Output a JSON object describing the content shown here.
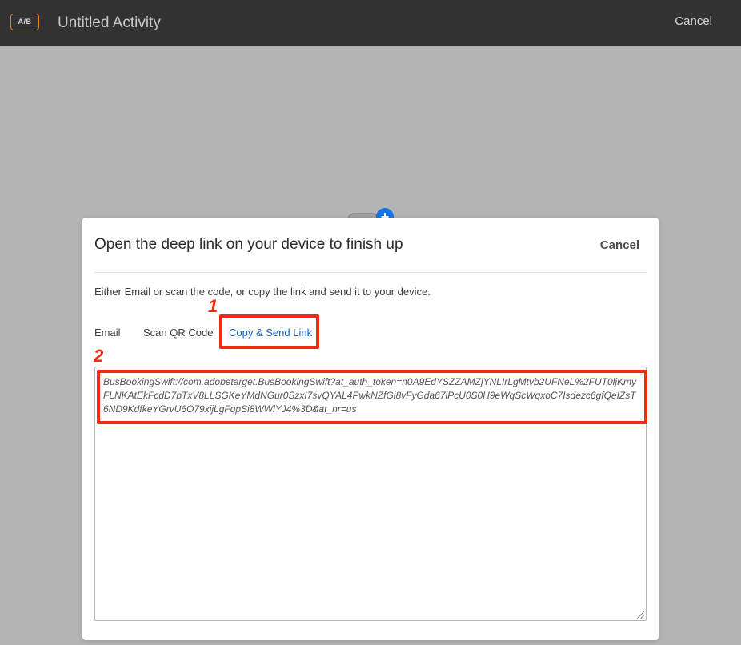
{
  "header": {
    "badge": "A/B",
    "title": "Untitled Activity",
    "cancel_label": "Cancel"
  },
  "background": {
    "plus_glyph": "+"
  },
  "modal": {
    "title": "Open the deep link on your device to finish up",
    "cancel_label": "Cancel",
    "instruction": "Either Email or scan the code, or copy the link and send it to your device.",
    "tabs": [
      {
        "label": "Email",
        "active": false
      },
      {
        "label": "Scan QR Code",
        "active": false
      },
      {
        "label": "Copy & Send Link",
        "active": true
      }
    ],
    "link_text": "BusBookingSwift://com.adobetarget.BusBookingSwift?at_auth_token=n0A9EdYSZZAMZjYNLIrLgMtvb2UFNeL%2FUT0ljKmyFLNKAtEkFcdD7bTxV8LLSGKeYMdNGur0SzxI7svQYAL4PwkNZfGi8vFyGda67lPcU0S0H9eWqScWqxoC7Isdezc6gfQeIZsT6ND9KdfkeYGrvU6O79xijLgFqpSi8WWlYJ4%3D&at_nr=us"
  },
  "annotations": {
    "callout_1": "1",
    "callout_2": "2",
    "color": "#f22a14"
  },
  "colors": {
    "topbar": "#323232",
    "overlay": "#b4b4b4",
    "badge_border": "#e68619",
    "active_tab": "#1361c4",
    "accent_blue": "#1473e6"
  }
}
